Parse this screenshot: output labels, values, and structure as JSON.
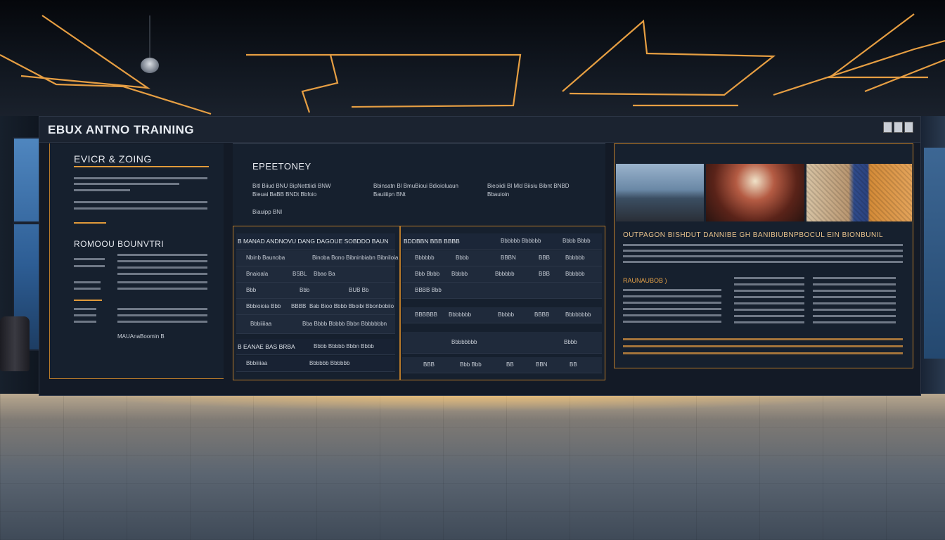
{
  "board": {
    "title": "EBUX ANTNO TRAINING"
  },
  "left_panel": {
    "heading": "EVICR & ZOING",
    "subheading": "ROMOOU BOUNVTRI",
    "footer": "MAUAnaBoomin B"
  },
  "top_panel": {
    "heading": "EPEETONEY",
    "bullets": [
      "Bitl Biiud BNU BipNetttiidi BNW",
      "Bbinsatn Bl BmuBioui Bdioioluaun",
      "Bieoiidi Bl Mld Biisiu Bibnt BNBD",
      "Bieuai BaBB BNDt Bbfoio",
      "Bauiiiipn BNt",
      "Bbauioin",
      "Biauipp BNI"
    ]
  },
  "mid_left": {
    "heading": "B MANAD ANDNOVU DANG  DAGOUE SOBDDO BAUN",
    "rows": [
      [
        "Nbinb Baunoba",
        "Binoba Bono Bibninbiabn Bibniloia"
      ],
      [
        "Bnaioala",
        "BSBL",
        "Bbao Ba"
      ],
      [
        "Bbb",
        "Bbb",
        "BUB Bb"
      ],
      [
        "Bbbioioia Bbb",
        "BBBB",
        "Bab Bioo Bbbb Bboibi Bbonbobiio"
      ],
      [
        "Bbbiiiiaa",
        "Bba Bbbb Bbbbb Bbbn Bbbbbbbn"
      ]
    ],
    "sub_heading": "B EANAE BAS BRBA",
    "sub_rows": [
      [
        "Bbbb Bbbbb Bbbn Bbbb"
      ],
      [
        "Bbbiiiiaa",
        "Bbbbbb Bbbbbb"
      ]
    ]
  },
  "mid_right": {
    "heading": "BDDBBN BBB BBBB",
    "columns": [
      "Bbbbbb Bbbbbb",
      "Bbbb Bbbb"
    ],
    "rows": [
      [
        "Bbbbbb",
        "Bbbb",
        "BBBN",
        "BBB",
        "Bbbbbb"
      ],
      [
        "Bbb Bbbb",
        "Bbbbb",
        "Bbbbbb",
        "BBB",
        "Bbbbbb"
      ],
      [
        "BBBB Bbb"
      ],
      [
        "BBBBBB",
        "Bbbbbbb",
        "Bbbbb",
        "BBBB",
        "Bbbbbbbb"
      ],
      [
        "Bbbbbbbb",
        "Bbbb"
      ],
      [
        "BBB",
        "Bbb Bbb",
        "BB",
        "BBN",
        "BB"
      ]
    ]
  },
  "right_panel": {
    "heading": "OUTPAGON BISHDUT  DANNIBE GH BANIBIUBNPBOCUL EIN BIONBUNIL",
    "label": "RAUNAUBOB )",
    "photos": [
      "lake-photo",
      "interior-photo",
      "pattern-photo"
    ]
  },
  "colors": {
    "accent": "#e19a3a",
    "board": "#131a26",
    "panel": "#16202e"
  }
}
